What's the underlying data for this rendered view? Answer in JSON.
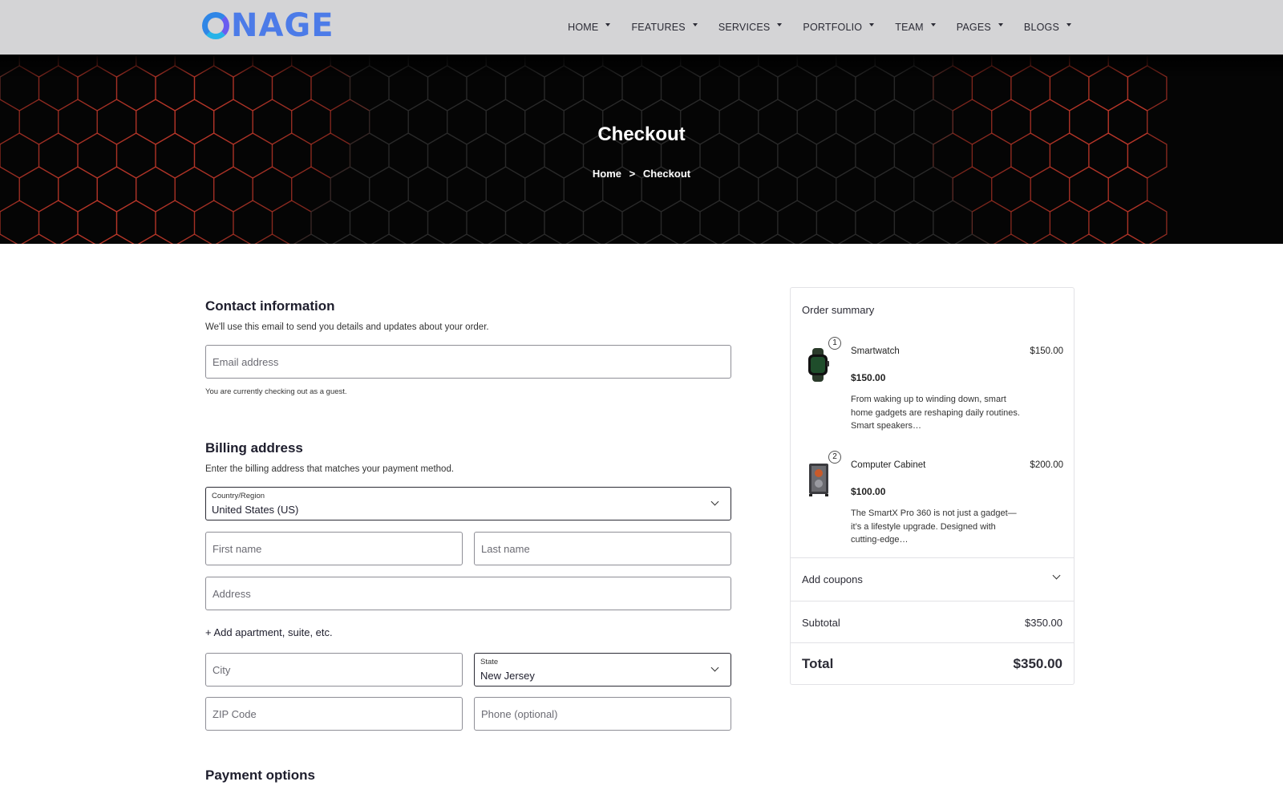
{
  "brand": {
    "logo_text": "NAGE"
  },
  "nav": [
    {
      "label": "HOME"
    },
    {
      "label": "FEATURES"
    },
    {
      "label": "SERVICES"
    },
    {
      "label": "PORTFOLIO"
    },
    {
      "label": "TEAM"
    },
    {
      "label": "PAGES"
    },
    {
      "label": "BLOGS"
    }
  ],
  "hero": {
    "title": "Checkout",
    "breadcrumb": {
      "home": "Home",
      "separator": ">",
      "current": "Checkout"
    }
  },
  "contact": {
    "title": "Contact information",
    "description": "We'll use this email to send you details and updates about your order.",
    "email_placeholder": "Email address",
    "guest_note": "You are currently checking out as a guest."
  },
  "billing": {
    "title": "Billing address",
    "description": "Enter the billing address that matches your payment method.",
    "country_label": "Country/Region",
    "country_value": "United States (US)",
    "first_name_placeholder": "First name",
    "last_name_placeholder": "Last name",
    "address_placeholder": "Address",
    "add_apartment": "+ Add apartment, suite, etc.",
    "city_placeholder": "City",
    "state_label": "State",
    "state_value": "New Jersey",
    "zip_placeholder": "ZIP Code",
    "phone_placeholder": "Phone (optional)"
  },
  "payment": {
    "title": "Payment options"
  },
  "summary": {
    "title": "Order summary",
    "items": [
      {
        "qty": "1",
        "name": "Smartwatch",
        "line_total": "$150.00",
        "price": "$150.00",
        "description": "From waking up to winding down, smart home gadgets are reshaping daily routines. Smart speakers…"
      },
      {
        "qty": "2",
        "name": "Computer Cabinet",
        "line_total": "$200.00",
        "price": "$100.00",
        "description": "The SmartX Pro 360 is not just a gadget—it’s a lifestyle upgrade. Designed with cutting-edge…"
      }
    ],
    "coupons_label": "Add coupons",
    "subtotal_label": "Subtotal",
    "subtotal_value": "$350.00",
    "total_label": "Total",
    "total_value": "$350.00"
  },
  "colors": {
    "accent_hex": "#4c7be8",
    "hero_hex_line": "#c0392b",
    "hero_bg": "#050505"
  }
}
